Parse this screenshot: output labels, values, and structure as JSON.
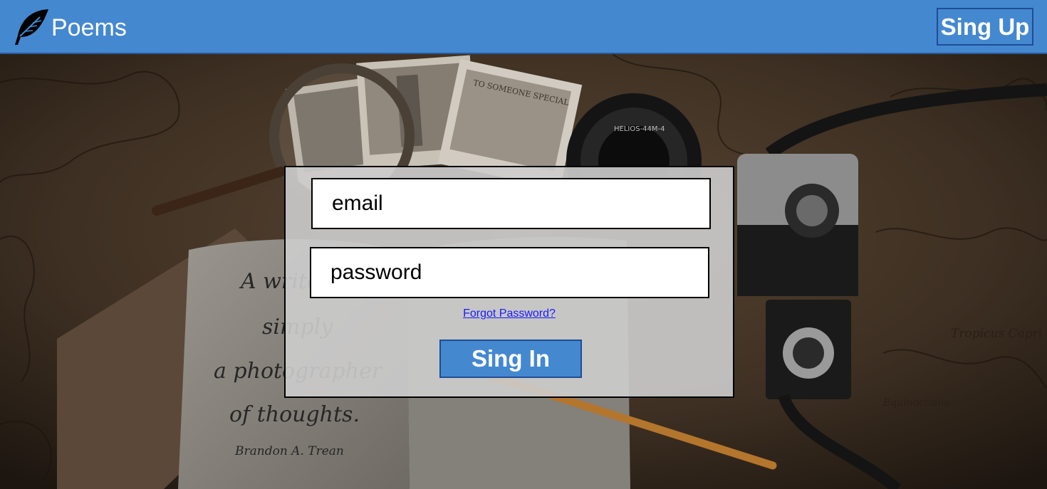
{
  "header": {
    "brand": "Poems",
    "logo_icon": "feather-icon",
    "signup_label": "Sing Up",
    "background_color": "#4488d0"
  },
  "login": {
    "email_placeholder": "email",
    "password_placeholder": "password",
    "forgot_label": "Forgot Password?",
    "signin_label": "Sing In"
  },
  "background": {
    "quote_lines": [
      "A writer is",
      "simply",
      "a photographer",
      "of thoughts."
    ],
    "quote_author": "Brandon A. Trean",
    "postcard_text": "TO SOMEONE SPECIAL",
    "lens_text": "HELIOS-44M-4",
    "map_labels": [
      "Tropicus Capri",
      "Equinoctialis"
    ]
  }
}
